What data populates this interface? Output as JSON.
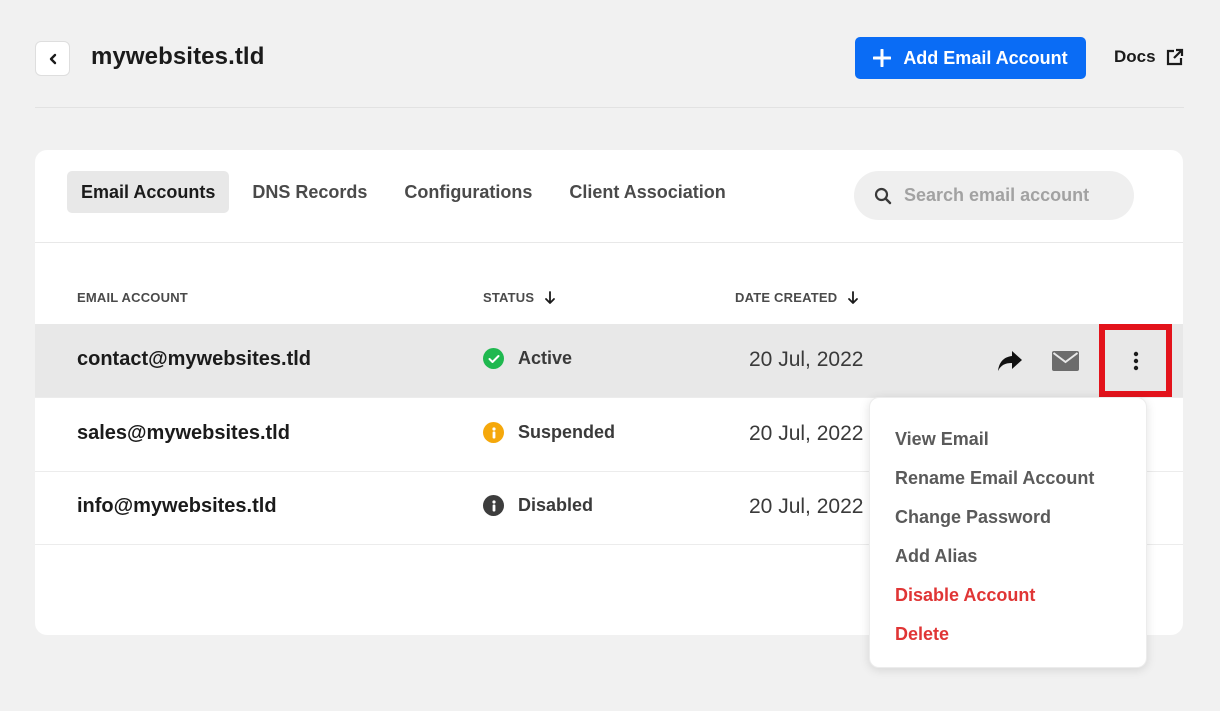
{
  "header": {
    "title": "mywebsites.tld",
    "add_button_label": "Add Email Account",
    "docs_label": "Docs"
  },
  "tabs": [
    {
      "label": "Email Accounts",
      "active": true
    },
    {
      "label": "DNS Records",
      "active": false
    },
    {
      "label": "Configurations",
      "active": false
    },
    {
      "label": "Client Association",
      "active": false
    }
  ],
  "search": {
    "placeholder": "Search email account",
    "value": ""
  },
  "table": {
    "columns": {
      "email": "EMAIL ACCOUNT",
      "status": "STATUS",
      "date": "DATE CREATED"
    },
    "rows": [
      {
        "email": "contact@mywebsites.tld",
        "status": "Active",
        "status_color": "#1fb84f",
        "date": "20 Jul, 2022"
      },
      {
        "email": "sales@mywebsites.tld",
        "status": "Suspended",
        "status_color": "#f5a80b",
        "date": "20 Jul, 2022"
      },
      {
        "email": "info@mywebsites.tld",
        "status": "Disabled",
        "status_color": "#3d3d3d",
        "date": "20 Jul, 2022"
      }
    ]
  },
  "row_actions": {
    "icons": [
      "forward-icon",
      "mail-icon",
      "kebab-menu-icon"
    ]
  },
  "context_menu": {
    "items": [
      {
        "label": "View Email",
        "danger": false
      },
      {
        "label": "Rename Email Account",
        "danger": false
      },
      {
        "label": "Change Password",
        "danger": false
      },
      {
        "label": "Add Alias",
        "danger": false
      },
      {
        "label": "Disable Account",
        "danger": true
      },
      {
        "label": "Delete",
        "danger": true
      }
    ]
  },
  "colors": {
    "accent": "#0a6cf5",
    "danger": "#e03535",
    "highlight_box": "#e3131b"
  }
}
